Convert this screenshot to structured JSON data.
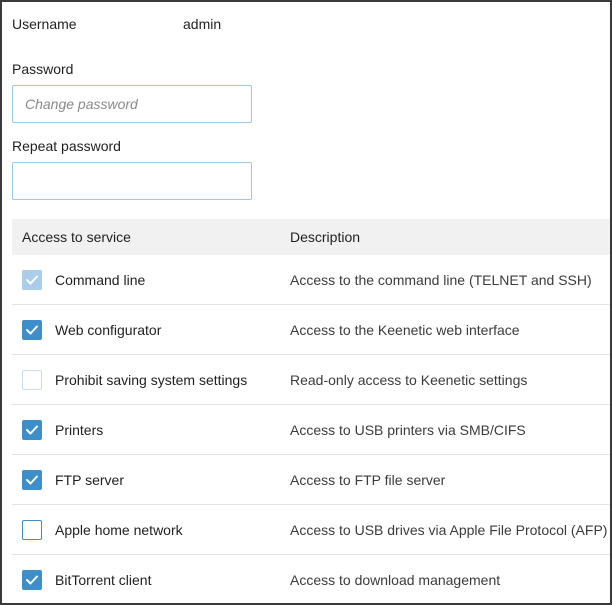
{
  "account": {
    "username_label": "Username",
    "username_value": "admin",
    "password_label": "Password",
    "password_placeholder": "Change password",
    "repeat_password_label": "Repeat password",
    "repeat_password_value": ""
  },
  "table": {
    "headers": {
      "service": "Access to service",
      "description": "Description"
    },
    "rows": [
      {
        "name": "Command line",
        "description": "Access to the command line (TELNET and SSH)",
        "state": "checked-disabled",
        "icon": "checkmark-icon"
      },
      {
        "name": "Web configurator",
        "description": "Access to the Keenetic web interface",
        "state": "checked",
        "icon": "checkmark-icon"
      },
      {
        "name": "Prohibit saving system settings",
        "description": "Read-only access to Keenetic settings",
        "state": "unchecked",
        "icon": ""
      },
      {
        "name": "Printers",
        "description": "Access to USB printers via SMB/CIFS",
        "state": "checked",
        "icon": "checkmark-icon"
      },
      {
        "name": "FTP server",
        "description": "Access to FTP file server",
        "state": "checked",
        "icon": "checkmark-icon"
      },
      {
        "name": "Apple home network",
        "description": "Access to USB drives via Apple File Protocol (AFP)",
        "state": "unchecked",
        "icon": ""
      },
      {
        "name": "BitTorrent client",
        "description": "Access to download management",
        "state": "checked",
        "icon": "checkmark-icon"
      }
    ]
  },
  "colors": {
    "accent": "#3e8fc9",
    "accent_disabled": "#a9cdea",
    "input_border": "#9cc9e6",
    "header_bg": "#f1f1f1",
    "row_divider": "#e3e3e3"
  }
}
